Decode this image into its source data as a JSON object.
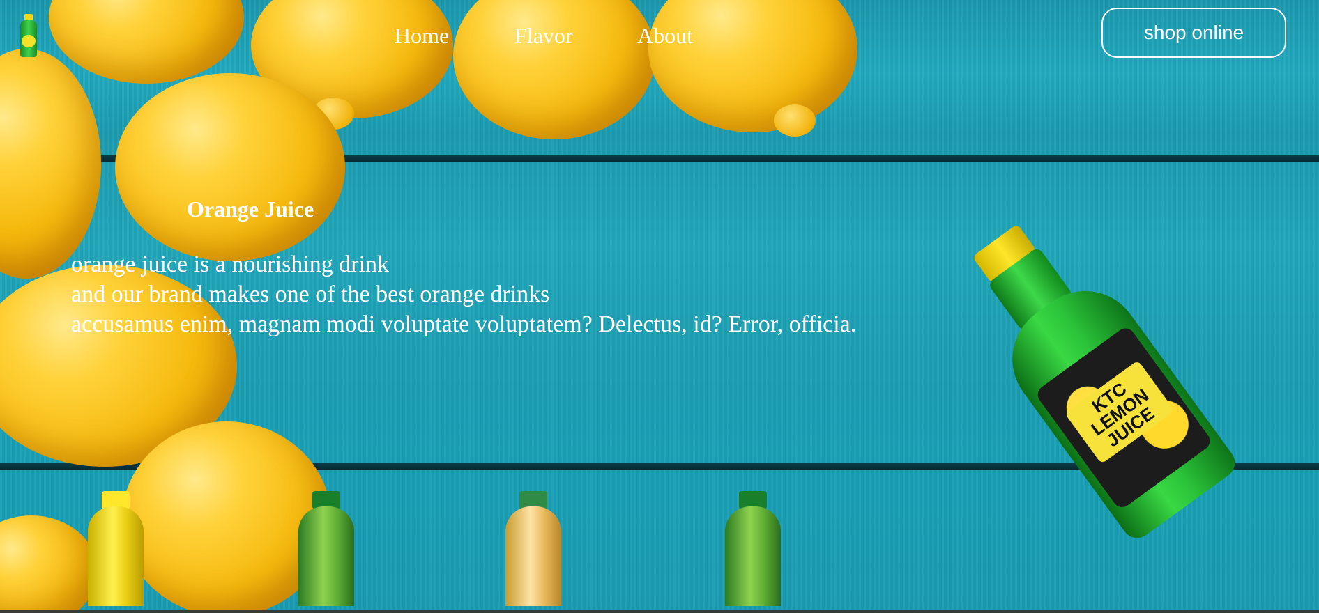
{
  "nav": {
    "items": [
      {
        "label": "Home"
      },
      {
        "label": "Flavor"
      },
      {
        "label": "About"
      }
    ]
  },
  "header": {
    "cta_label": "shop online"
  },
  "hero": {
    "title": "Orange Juice",
    "lines": [
      "orange juice is a nourishing drink",
      "and our brand makes one of the best orange drinks",
      "accusamus enim, magnam modi voluptate voluptatem? Delectus, id? Error, officia."
    ]
  },
  "product": {
    "label_text": "LEMON JUICE",
    "brand_text": "KTC"
  },
  "colors": {
    "background": "#1f9fb3",
    "text": "#ffffff",
    "lemon": "#f5b90d",
    "bottle_green": "#2bc239"
  },
  "icons": {
    "logo": "lemon-juice-bottle-icon"
  }
}
